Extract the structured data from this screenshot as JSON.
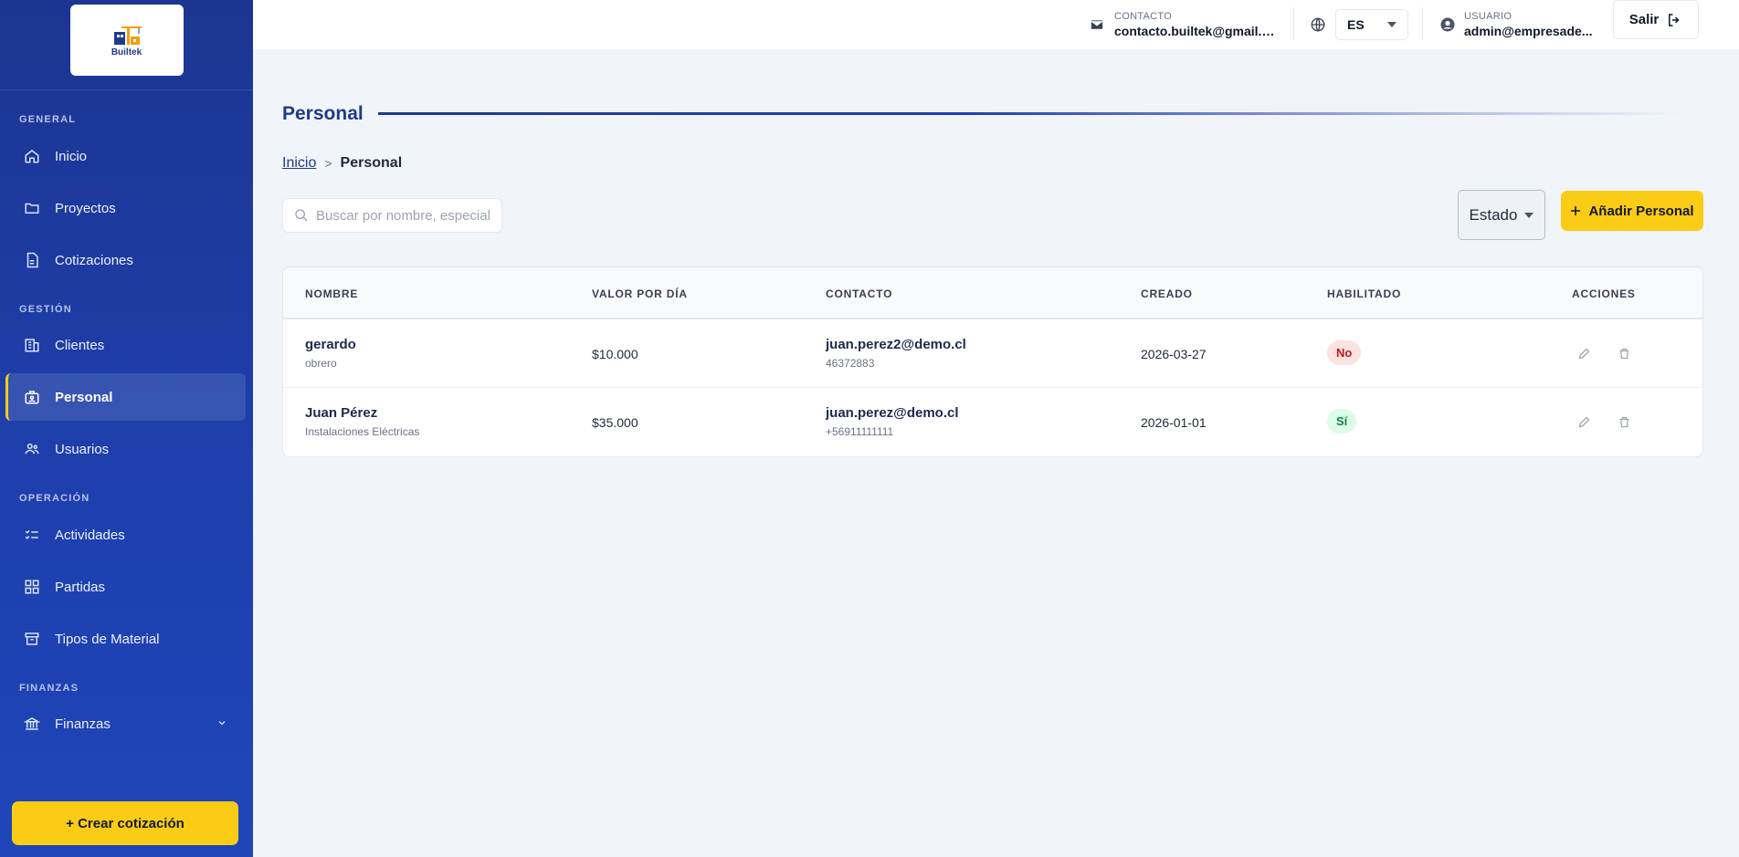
{
  "brand": {
    "logo_text": "Builtek"
  },
  "sidebar": {
    "sections": {
      "general": "GENERAL",
      "gestion": "GESTIÓN",
      "operacion": "OPERACIÓN",
      "finanzas": "FINANZAS"
    },
    "items": [
      {
        "label": "Inicio",
        "icon": "home-icon"
      },
      {
        "label": "Proyectos",
        "icon": "folder-icon"
      },
      {
        "label": "Cotizaciones",
        "icon": "document-icon"
      },
      {
        "label": "Clientes",
        "icon": "building-icon"
      },
      {
        "label": "Personal",
        "icon": "badge-icon",
        "active": true
      },
      {
        "label": "Usuarios",
        "icon": "users-icon"
      },
      {
        "label": "Actividades",
        "icon": "checklist-icon"
      },
      {
        "label": "Partidas",
        "icon": "grid-icon"
      },
      {
        "label": "Tipos de Material",
        "icon": "archive-icon"
      },
      {
        "label": "Finanzas",
        "icon": "bank-icon"
      }
    ],
    "create_button": "+ Crear cotización"
  },
  "header": {
    "contact_label": "CONTACTO",
    "contact_value": "contacto.builtek@gmail.c...",
    "language": "ES",
    "user_label": "USUARIO",
    "user_value": "admin@empresade...",
    "logout_label": "Salir"
  },
  "main": {
    "title": "Personal",
    "breadcrumb": {
      "home": "Inicio",
      "separator": ">",
      "current": "Personal"
    },
    "search_placeholder": "Buscar por nombre, especial",
    "estado_label": "Estado",
    "add_button": "Añadir Personal"
  },
  "table": {
    "columns": [
      "NOMBRE",
      "VALOR POR DÍA",
      "CONTACTO",
      "CREADO",
      "HABILITADO",
      "ACCIONES"
    ],
    "rows": [
      {
        "name": "gerardo",
        "role": "obrero",
        "value": "$10.000",
        "email": "juan.perez2@demo.cl",
        "phone": "46372883",
        "created": "2026-03-27",
        "enabled": "No"
      },
      {
        "name": "Juan Pérez",
        "role": "Instalaciones Eléctricas",
        "value": "$35.000",
        "email": "juan.perez@demo.cl",
        "phone": "+56911111111",
        "created": "2026-01-01",
        "enabled": "Sí"
      }
    ]
  },
  "colors": {
    "sidebar": "#1e40af",
    "accent": "#facc15",
    "title": "#1e3a8a",
    "badge_no_bg": "#fde2e2",
    "badge_si_bg": "#dcfce7"
  }
}
